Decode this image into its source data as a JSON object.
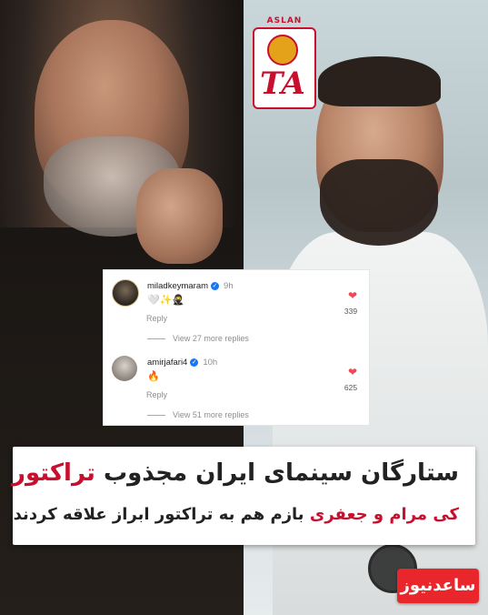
{
  "logo": {
    "top_text": "ASLAN",
    "main_text": "TA"
  },
  "comments": [
    {
      "username": "miladkeymaram",
      "time": "9h",
      "body": "🤍✨🥷",
      "reply_label": "Reply",
      "likes": "339",
      "view_replies": "View 27 more replies"
    },
    {
      "username": "amirjafari4",
      "time": "10h",
      "body": "🔥",
      "reply_label": "Reply",
      "likes": "625",
      "view_replies": "View 51 more replies"
    }
  ],
  "banner": {
    "headline_prefix": "ستارگان سینمای ایران مجذوب ",
    "headline_red": "تراکتور",
    "headline_suffix": " !",
    "subline_red": "کی مرام و جعفری",
    "subline_rest": " بازم هم به تراکتور ابراز علاقه کردند"
  },
  "brand": {
    "name": "ساعدنیوز"
  },
  "colors": {
    "accent_red": "#c8102e",
    "heart_red": "#ed4956",
    "verified_blue": "#1877f2",
    "badge_red": "#e8262b"
  }
}
